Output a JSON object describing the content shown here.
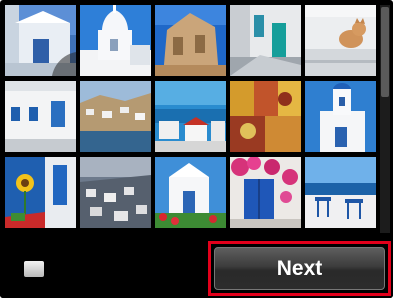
{
  "photos": [
    {
      "name": "photo-white-chapel-blue-door",
      "selected": true
    },
    {
      "name": "photo-white-church-blue-sky",
      "selected": false
    },
    {
      "name": "photo-stone-ruins-blue-sky",
      "selected": false
    },
    {
      "name": "photo-white-alley-turquoise-door",
      "selected": false
    },
    {
      "name": "photo-cat-on-white-steps",
      "selected": false
    },
    {
      "name": "photo-white-house-blue-windows",
      "selected": false
    },
    {
      "name": "photo-harbor-town-hillside",
      "selected": false
    },
    {
      "name": "photo-seaside-village-red-roof",
      "selected": false
    },
    {
      "name": "photo-spice-market-colors",
      "selected": false
    },
    {
      "name": "photo-white-chapel-blue-bell-tower",
      "selected": false
    },
    {
      "name": "photo-sunflower-blue-wall",
      "selected": false
    },
    {
      "name": "photo-hillside-village-dusk",
      "selected": false
    },
    {
      "name": "photo-white-chapel-red-flowers",
      "selected": false
    },
    {
      "name": "photo-blue-shutters-bougainvillea",
      "selected": false
    },
    {
      "name": "photo-blue-chairs-sea-view",
      "selected": false
    }
  ],
  "next_button": {
    "label": "Next"
  },
  "colors": {
    "highlight": "#e3001b",
    "screen_bg": "#000000"
  },
  "icons": {
    "menu": "menu-square-icon",
    "selected": "checkmark-icon"
  }
}
